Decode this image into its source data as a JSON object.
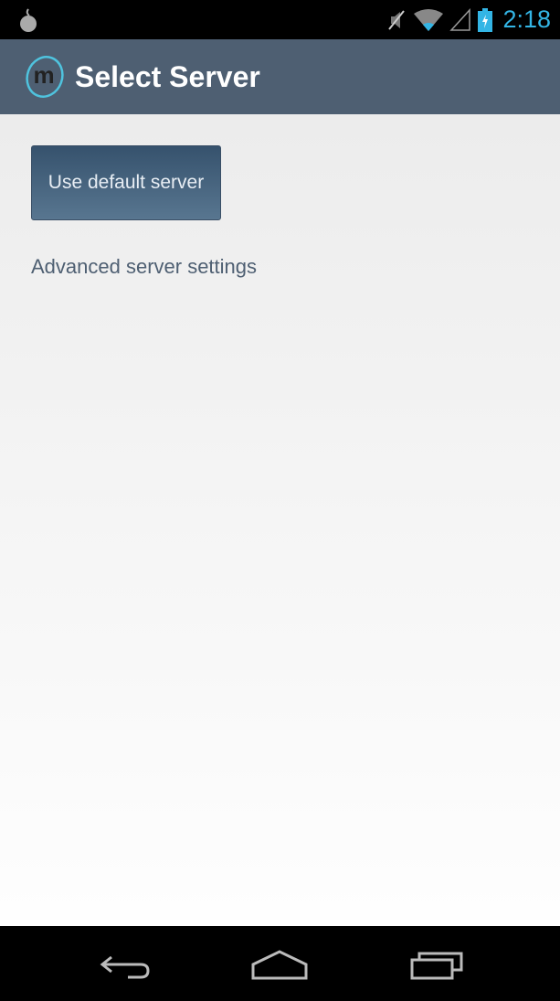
{
  "status_bar": {
    "time": "2:18",
    "icons": [
      "app-notification-icon",
      "mute-icon",
      "wifi-icon",
      "signal-icon",
      "battery-charging-icon"
    ],
    "accent_color": "#33b5e5"
  },
  "action_bar": {
    "title": "Select Server",
    "logo_letter": "m",
    "background_color": "#4e5f72"
  },
  "main": {
    "default_server_button": "Use default server",
    "advanced_link": "Advanced server settings"
  },
  "nav_bar": {
    "buttons": [
      "back-icon",
      "home-icon",
      "recents-icon"
    ]
  }
}
